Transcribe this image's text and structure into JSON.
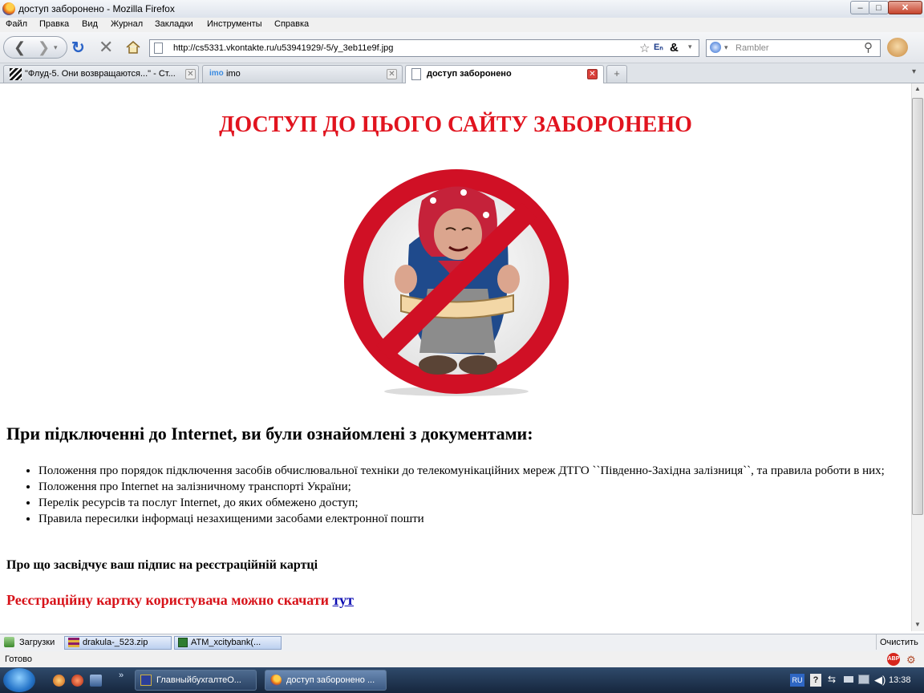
{
  "window": {
    "title": "доступ заборонено - Mozilla Firefox",
    "min": "–",
    "max": "□",
    "close": "✕"
  },
  "menu": [
    "Файл",
    "Правка",
    "Вид",
    "Журнал",
    "Закладки",
    "Инструменты",
    "Справка"
  ],
  "navbar": {
    "url": "http://cs5331.vkontakte.ru/u53941929/-5/y_3eb11e9f.jpg",
    "search_placeholder": "Rambler"
  },
  "tabs": [
    {
      "label": "\"Флуд-5. Они возвращаются...\" - Ст...",
      "active": false
    },
    {
      "label": "imo",
      "icon_text": "imo",
      "active": false
    },
    {
      "label": "доступ заборонено",
      "active": true
    }
  ],
  "tab_new": "+",
  "tab_list": "▾",
  "page": {
    "heading": "ДОСТУП ДО ЦЬОГО САЙТУ ЗАБОРОНЕНО",
    "subheading": "При підключенні до Internet, ви були ознайомлені з документами:",
    "documents": [
      "Положення про порядок підключення засобів обчислювальної техніки до телекомунікаційних мереж ДТГО ``Південно-Західна залізниця``, та правила роботи в них;",
      "Положення про Internet на залізничному транспорті України;",
      "Перелік ресурсів та послуг Internet, до яких обмежено доступ;",
      "Правила пересилки інформаці незахищеними засобами електронної пошти"
    ],
    "signature_note": "Про що засвідчує ваш підпис на реєстраційній картці",
    "download_text": "Реєстраційну картку користувача можно скачати",
    "download_link": "тут"
  },
  "download_bar": {
    "label": "Загрузки",
    "items": [
      "drakula-_523.zip",
      "ATM_xcitybank(..."
    ],
    "clear": "Очистить"
  },
  "status": {
    "text": "Готово"
  },
  "taskbar": {
    "tasks": [
      "ГлавныйбухгалтеО...",
      "доступ заборонено ..."
    ],
    "language": "RU",
    "clock": "13:38"
  },
  "colors": {
    "heading": "#e1141f",
    "link": "#0b0bb2",
    "sign_red": "#d01025"
  }
}
